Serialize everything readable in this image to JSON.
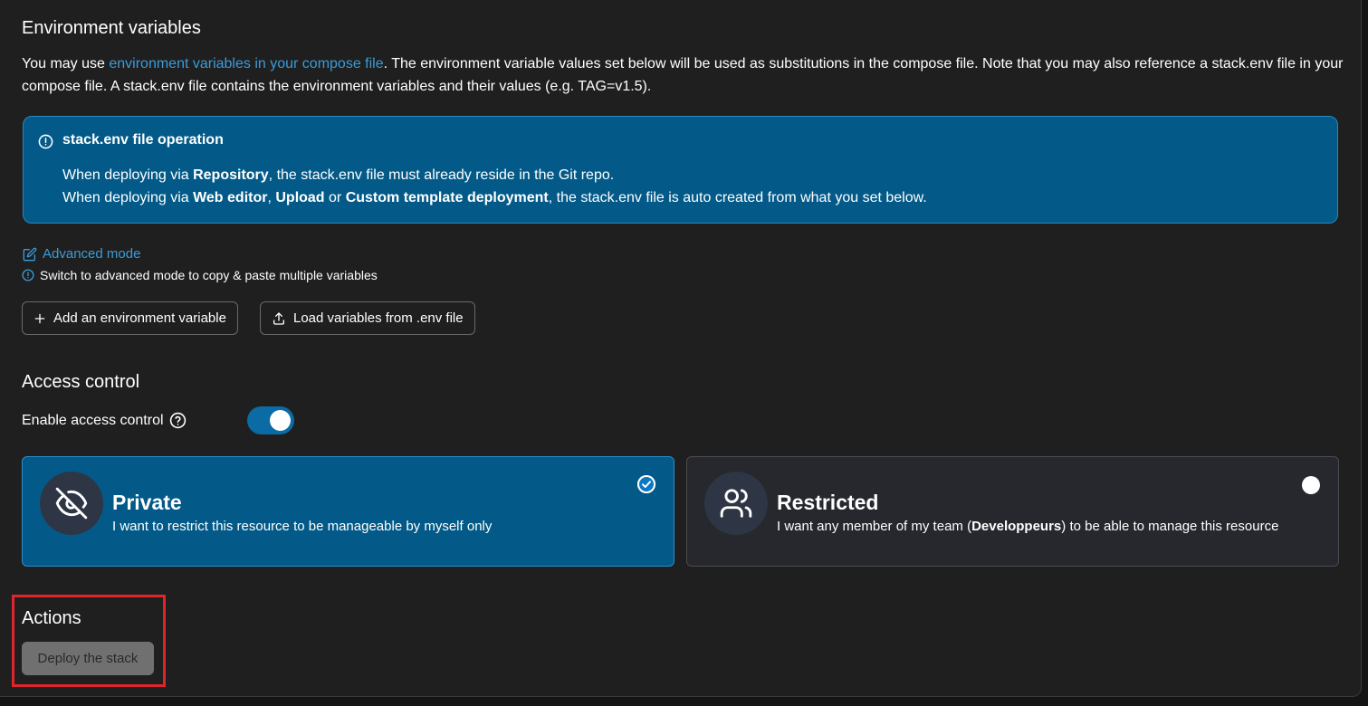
{
  "env": {
    "title": "Environment variables",
    "desc_prefix": "You may use ",
    "desc_link": "environment variables in your compose file",
    "desc_suffix": ". The environment variable values set below will be used as substitutions in the compose file. Note that you may also reference a stack.env file in your compose file. A stack.env file contains the environment variables and their values (e.g. TAG=v1.5).",
    "info": {
      "title": "stack.env file operation",
      "line1_prefix": "When deploying via ",
      "line1_bold": "Repository",
      "line1_suffix": ", the stack.env file must already reside in the Git repo.",
      "line2_prefix": "When deploying via ",
      "line2_bold1": "Web editor",
      "line2_sep1": ", ",
      "line2_bold2": "Upload",
      "line2_sep2": " or ",
      "line2_bold3": "Custom template deployment",
      "line2_suffix": ", the stack.env file is auto created from what you set below."
    },
    "advanced_mode_label": "Advanced mode",
    "advanced_mode_hint": "Switch to advanced mode to copy & paste multiple variables",
    "add_button_label": "Add an environment variable",
    "load_button_label": "Load variables from .env file"
  },
  "access": {
    "title": "Access control",
    "enable_label": "Enable access control",
    "enabled": true,
    "private": {
      "title": "Private",
      "desc": "I want to restrict this resource to be manageable by myself only",
      "selected": true
    },
    "restricted": {
      "title": "Restricted",
      "desc_prefix": "I want any member of my team (",
      "desc_team": "Developpeurs",
      "desc_suffix": ") to be able to manage this resource",
      "selected": false
    }
  },
  "actions": {
    "title": "Actions",
    "deploy_label": "Deploy the stack"
  },
  "colors": {
    "accent": "#035a88",
    "link": "#3b9bd9",
    "highlight": "#e0242c"
  }
}
